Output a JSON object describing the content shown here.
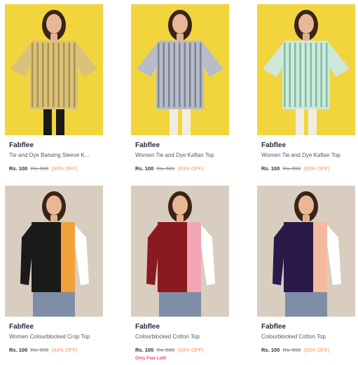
{
  "products": [
    {
      "brand": "Fabflee",
      "title": "Tie and Dye Batwing Sleeve K...",
      "price": "Rs. 100",
      "mrp": "Rs. 599",
      "discount": "(83% OFF)",
      "alert": "",
      "image": {
        "background": "#f2d53d",
        "garment": [
          "#d9c27a",
          "#8a6a2a"
        ]
      }
    },
    {
      "brand": "Fabflee",
      "title": "Women Tie and Dye Kaftan Top",
      "price": "Rs. 100",
      "mrp": "Rs. 599",
      "discount": "(83% OFF)",
      "alert": "",
      "image": {
        "background": "#f2d53d",
        "garment": [
          "#b7bcc8",
          "#4d5470"
        ]
      }
    },
    {
      "brand": "Fabflee",
      "title": "Women Tie and Dye Kaftan Top",
      "price": "Rs. 100",
      "mrp": "Rs. 599",
      "discount": "(83% OFF)",
      "alert": "",
      "image": {
        "background": "#f2d53d",
        "garment": [
          "#cfe8dc",
          "#3b9a7a"
        ]
      }
    },
    {
      "brand": "Fabflee",
      "title": "Women Colourblocked Crop Top",
      "price": "Rs. 100",
      "mrp": "Rs. 599",
      "discount": "(83% OFF)",
      "alert": "",
      "image": {
        "background": "#d9cdbf",
        "garment": [
          "#1a1a1a",
          "#f2a23a",
          "#ffffff"
        ]
      }
    },
    {
      "brand": "Fabflee",
      "title": "Colourblocked Cotton Top",
      "price": "Rs. 100",
      "mrp": "Rs. 599",
      "discount": "(83% OFF)",
      "alert": "Only Few Left!",
      "image": {
        "background": "#d9cdbf",
        "garment": [
          "#8a1a1f",
          "#f2a6b4",
          "#ffffff"
        ]
      }
    },
    {
      "brand": "Fabflee",
      "title": "Colourblocked Cotton Top",
      "price": "Rs. 100",
      "mrp": "Rs. 599",
      "discount": "(83% OFF)",
      "alert": "",
      "image": {
        "background": "#d9cdbf",
        "garment": [
          "#2a1a4a",
          "#f5b9a0",
          "#ffffff"
        ]
      }
    }
  ]
}
